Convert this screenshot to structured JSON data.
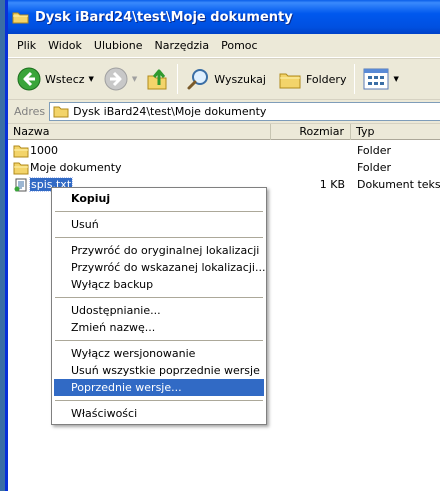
{
  "window": {
    "title": "Dysk iBard24\\test\\Moje dokumenty"
  },
  "menu": [
    "Plik",
    "Widok",
    "Ulubione",
    "Narzędzia",
    "Pomoc"
  ],
  "toolbar": {
    "back": "Wstecz",
    "search": "Wyszukaj",
    "folders": "Foldery"
  },
  "address": {
    "label": "Adres",
    "value": "Dysk iBard24\\test\\Moje dokumenty"
  },
  "columns": {
    "name": "Nazwa",
    "size": "Rozmiar",
    "type": "Typ"
  },
  "files": [
    {
      "name": "1000",
      "size": "",
      "type": "Folder",
      "icon": "folder-icon"
    },
    {
      "name": "Moje dokumenty",
      "size": "",
      "type": "Folder",
      "icon": "folder-icon"
    },
    {
      "name": "spis.txt",
      "size": "1 KB",
      "type": "Dokument tekstowy",
      "icon": "text-file-icon",
      "selected": true
    }
  ],
  "context_menu": {
    "copy": "Kopiuj",
    "delete": "Usuń",
    "restore_original": "Przywróć do oryginalnej lokalizacji",
    "restore_chosen": "Przywróć do wskazanej lokalizacji...",
    "disable_backup": "Wyłącz backup",
    "sharing": "Udostępnianie...",
    "rename": "Zmień nazwę...",
    "disable_versioning": "Wyłącz wersjonowanie",
    "delete_versions": "Usuń wszystkie poprzednie wersje",
    "previous_versions": "Poprzednie wersje...",
    "properties": "Właściwości"
  },
  "colors": {
    "selection": "#316ac5",
    "titlebar": "#0058ee",
    "chrome": "#ece9d8"
  }
}
